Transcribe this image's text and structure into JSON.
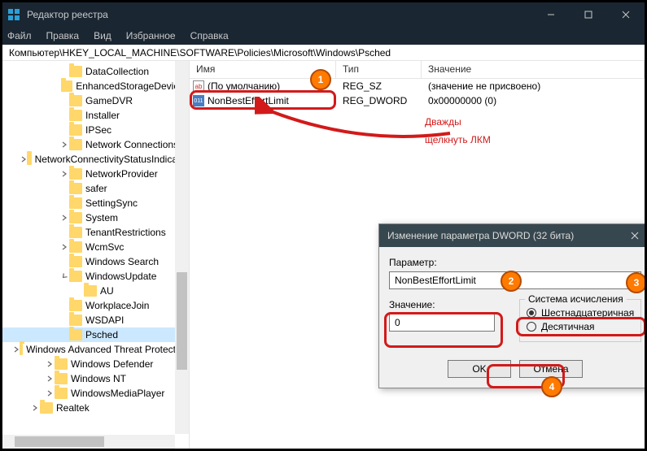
{
  "title": "Редактор реестра",
  "menu": {
    "file": "Файл",
    "edit": "Правка",
    "view": "Вид",
    "fav": "Избранное",
    "help": "Справка"
  },
  "path": "Компьютер\\HKEY_LOCAL_MACHINE\\SOFTWARE\\Policies\\Microsoft\\Windows\\Psched",
  "list": {
    "headers": {
      "name": "Имя",
      "type": "Тип",
      "value": "Значение"
    },
    "rows": [
      {
        "name": "(По умолчанию)",
        "type": "REG_SZ",
        "value": "(значение не присвоено)"
      },
      {
        "name": "NonBestEffortLimit",
        "type": "REG_DWORD",
        "value": "0x00000000 (0)"
      }
    ]
  },
  "tree": [
    {
      "d": 3,
      "c": 0,
      "l": "DataCollection"
    },
    {
      "d": 3,
      "c": 0,
      "l": "EnhancedStorageDevices"
    },
    {
      "d": 3,
      "c": 0,
      "l": "GameDVR"
    },
    {
      "d": 3,
      "c": 0,
      "l": "Installer"
    },
    {
      "d": 3,
      "c": 0,
      "l": "IPSec"
    },
    {
      "d": 3,
      "c": 1,
      "l": "Network Connections"
    },
    {
      "d": 3,
      "c": 1,
      "l": "NetworkConnectivityStatusIndicator"
    },
    {
      "d": 3,
      "c": 1,
      "l": "NetworkProvider"
    },
    {
      "d": 3,
      "c": 0,
      "l": "safer"
    },
    {
      "d": 3,
      "c": 0,
      "l": "SettingSync"
    },
    {
      "d": 3,
      "c": 1,
      "l": "System"
    },
    {
      "d": 3,
      "c": 0,
      "l": "TenantRestrictions"
    },
    {
      "d": 3,
      "c": 1,
      "l": "WcmSvc"
    },
    {
      "d": 3,
      "c": 0,
      "l": "Windows Search"
    },
    {
      "d": 3,
      "c": 2,
      "l": "WindowsUpdate"
    },
    {
      "d": 4,
      "c": 0,
      "l": "AU"
    },
    {
      "d": 3,
      "c": 0,
      "l": "WorkplaceJoin"
    },
    {
      "d": 3,
      "c": 0,
      "l": "WSDAPI"
    },
    {
      "d": 3,
      "c": 0,
      "l": "Psched",
      "sel": true
    },
    {
      "d": 2,
      "c": 1,
      "l": "Windows Advanced Threat Protection"
    },
    {
      "d": 2,
      "c": 1,
      "l": "Windows Defender"
    },
    {
      "d": 2,
      "c": 1,
      "l": "Windows NT"
    },
    {
      "d": 2,
      "c": 1,
      "l": "WindowsMediaPlayer"
    },
    {
      "d": 1,
      "c": 1,
      "l": "Realtek"
    }
  ],
  "dialog": {
    "title": "Изменение параметра DWORD (32 бита)",
    "paramLabel": "Параметр:",
    "paramValue": "NonBestEffortLimit",
    "valueLabel": "Значение:",
    "valueValue": "0",
    "baseLabel": "Система исчисления",
    "hex": "Шестнадцатеричная",
    "dec": "Десятичная",
    "ok": "OK",
    "cancel": "Отмена"
  },
  "callout": {
    "line1": "Дважды",
    "line2": "щелкнуть ЛКМ"
  },
  "badges": {
    "b1": "1",
    "b2": "2",
    "b3": "3",
    "b4": "4"
  }
}
